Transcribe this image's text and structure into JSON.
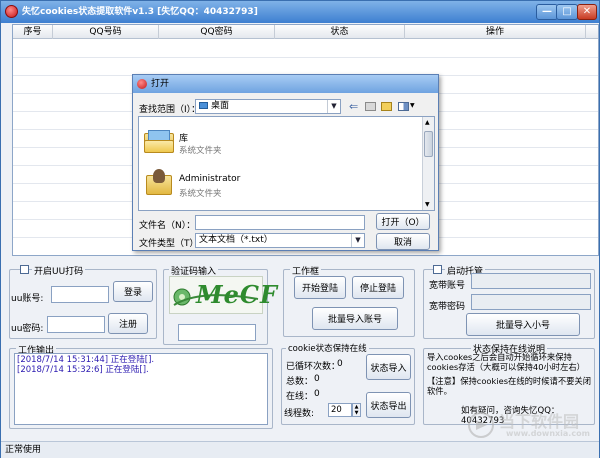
{
  "app": {
    "title": "失忆cookies状态提取软件v1.3  [失忆QQ：40432793]",
    "window_min": "—",
    "window_max": "□",
    "window_close": "✕"
  },
  "table": {
    "columns": [
      "序号",
      "QQ号码",
      "QQ密码",
      "状态",
      "操作"
    ]
  },
  "uu_panel": {
    "checkbox_label": "开启UU打码",
    "account_label": "uu账号:",
    "password_label": "uu密码:",
    "login_button": "登录",
    "register_button": "注册"
  },
  "captcha": {
    "legend": "验证码输入",
    "image_text": "MeCF"
  },
  "workbox": {
    "legend": "工作框",
    "start_login": "开始登陆",
    "stop_login": "停止登陆",
    "batch_import": "批量导入账号"
  },
  "broadband": {
    "checkbox_label": "启动托管",
    "account_label": "宽带账号",
    "password_label": "宽带密码",
    "batch_import_button": "批量导入小号"
  },
  "output": {
    "legend": "工作输出",
    "lines": [
      "[2018/7/14 15:31:44] 正在登陆[].",
      "[2018/7/14 15:32:6] 正在登陆[]."
    ]
  },
  "cookie_panel": {
    "legend": "cookie状态保持在线",
    "cycle_label": "已循环次数：",
    "cycle_value": "0",
    "total_label": "总数：",
    "total_value": "0",
    "online_label": "在线：",
    "online_value": "0",
    "threads_label": "线程数:",
    "threads_value": "20",
    "import_button": "状态导入",
    "export_button": "状态导出"
  },
  "help_panel": {
    "legend": "状态保持在线说明",
    "text1": "导入cookes之后会自动开始循环来保持cookies存活（大概可以保持40小时左右）",
    "text2": "【注意】保持cookies在线的时候请不要关闭软件。",
    "contact": "如有疑问，咨询失忆QQ：40432793"
  },
  "status_bar": {
    "text": "正常使用"
  },
  "dialog": {
    "title": "打开",
    "lookin_label": "查找范围（I）：",
    "lookin_value": "桌面",
    "items": [
      {
        "name": "库",
        "type": "系统文件夹"
      },
      {
        "name": "Administrator",
        "type": "系统文件夹"
      }
    ],
    "filename_label": "文件名（N）：",
    "filetype_label": "文件类型（T）：",
    "filetype_value": "文本文档（*.txt）",
    "open_button": "打开（O）",
    "cancel_button": "取消"
  },
  "watermark": {
    "brand": "当下软件园",
    "url": "www.downxia.com"
  },
  "colors": {
    "title_bar": "#3d7fd0",
    "log_text": "#2b1ab0",
    "accent_green": "#2e8b2e"
  }
}
